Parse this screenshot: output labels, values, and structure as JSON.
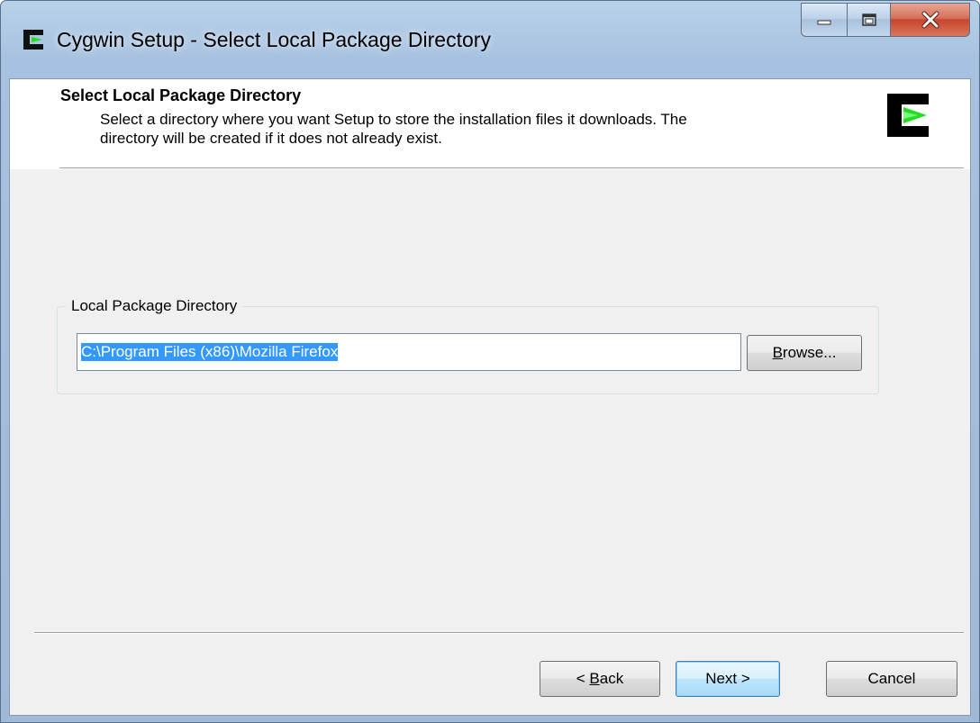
{
  "window": {
    "title": "Cygwin Setup - Select Local Package Directory",
    "icon": "cygwin-logo-icon"
  },
  "header": {
    "title": "Select Local Package Directory",
    "description": "Select a directory where you want Setup to store the installation files it downloads.  The directory will be created if it does not already exist.",
    "logo": "cygwin-logo-icon"
  },
  "group": {
    "label": "Local Package Directory",
    "directory_value": "C:\\Program Files (x86)\\Mozilla Firefox",
    "browse_label_pre": "",
    "browse_label_key": "B",
    "browse_label_post": "rowse..."
  },
  "footer": {
    "back_pre": "< ",
    "back_key": "B",
    "back_post": "ack",
    "next_label": "Next >",
    "cancel_label": "Cancel"
  },
  "colors": {
    "selection": "#3399ff",
    "cygwin_green": "#22dd22",
    "close_button": "#c7462d"
  }
}
